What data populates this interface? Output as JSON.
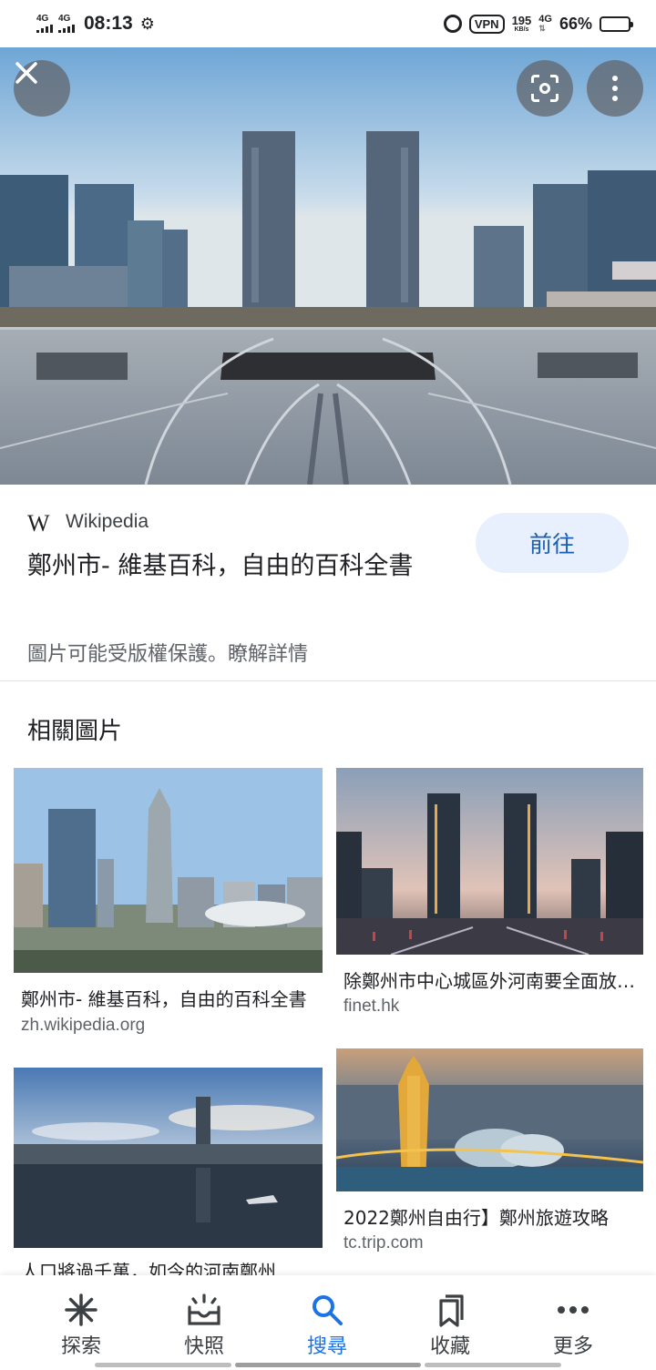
{
  "status_bar": {
    "network_1": "4G",
    "network_2": "4G",
    "time": "08:13",
    "vpn": "VPN",
    "speed_value": "195",
    "speed_unit": "KB/s",
    "network_3": "4G",
    "battery_percent": "66%",
    "battery_level": 0.66
  },
  "viewer": {
    "close_icon": "close-icon",
    "lens_icon": "google-lens-icon",
    "more_icon": "more-vert-icon"
  },
  "source": {
    "site_name": "Wikipedia",
    "logo_text": "W",
    "title": "鄭州市- 維基百科，自由的百科全書",
    "visit_label": "前往",
    "copyright_notice": "圖片可能受版權保護。瞭解詳情"
  },
  "related": {
    "heading": "相關圖片",
    "items": [
      {
        "title": "鄭州市- 維基百科，自由的百科全書",
        "domain": "zh.wikipedia.org"
      },
      {
        "title": "除鄭州市中心城區外河南要全面放開落戶限制",
        "domain": "finet.hk"
      },
      {
        "title": "人口將過千萬，如今的河南鄭州",
        "domain": ""
      },
      {
        "title": "2022鄭州自由行】鄭州旅遊攻略",
        "domain": "tc.trip.com"
      }
    ]
  },
  "bottom_nav": {
    "items": [
      {
        "label": "探索",
        "icon": "asterisk-icon"
      },
      {
        "label": "快照",
        "icon": "snapshot-inbox-icon"
      },
      {
        "label": "搜尋",
        "icon": "search-icon"
      },
      {
        "label": "收藏",
        "icon": "collections-icon"
      },
      {
        "label": "更多",
        "icon": "more-horiz-icon"
      }
    ],
    "active_index": 2
  }
}
